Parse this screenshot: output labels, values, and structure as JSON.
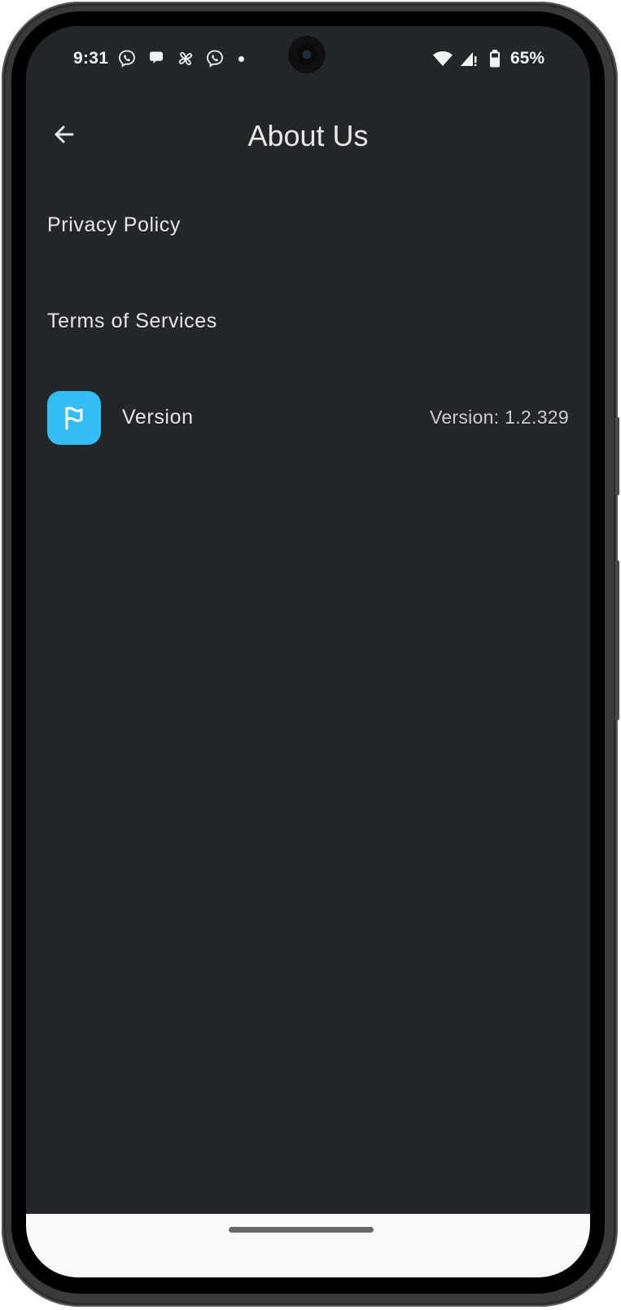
{
  "status_bar": {
    "time": "9:31",
    "notification_icons": [
      "viber-icon",
      "chat-bubble-icon",
      "pinwheel-icon",
      "viber-icon",
      "dot-icon"
    ],
    "system_icons": [
      "wifi-icon",
      "cellular-signal-no-data-icon",
      "battery-icon"
    ],
    "battery_percent": "65%"
  },
  "app_bar": {
    "back_icon": "arrow-left-icon",
    "title": "About Us"
  },
  "menu": {
    "items": [
      {
        "label": "Privacy Policy"
      },
      {
        "label": "Terms of Services"
      },
      {
        "label": "Version",
        "icon": "flag-icon",
        "value": "Version: 1.2.329"
      }
    ]
  },
  "colors": {
    "background": "#25262a",
    "accent_icon_bg": "#35bdf5",
    "text_primary": "#e8e4e8",
    "text_secondary": "#cfcbd0",
    "nav_bar": "#f8f8f8"
  }
}
